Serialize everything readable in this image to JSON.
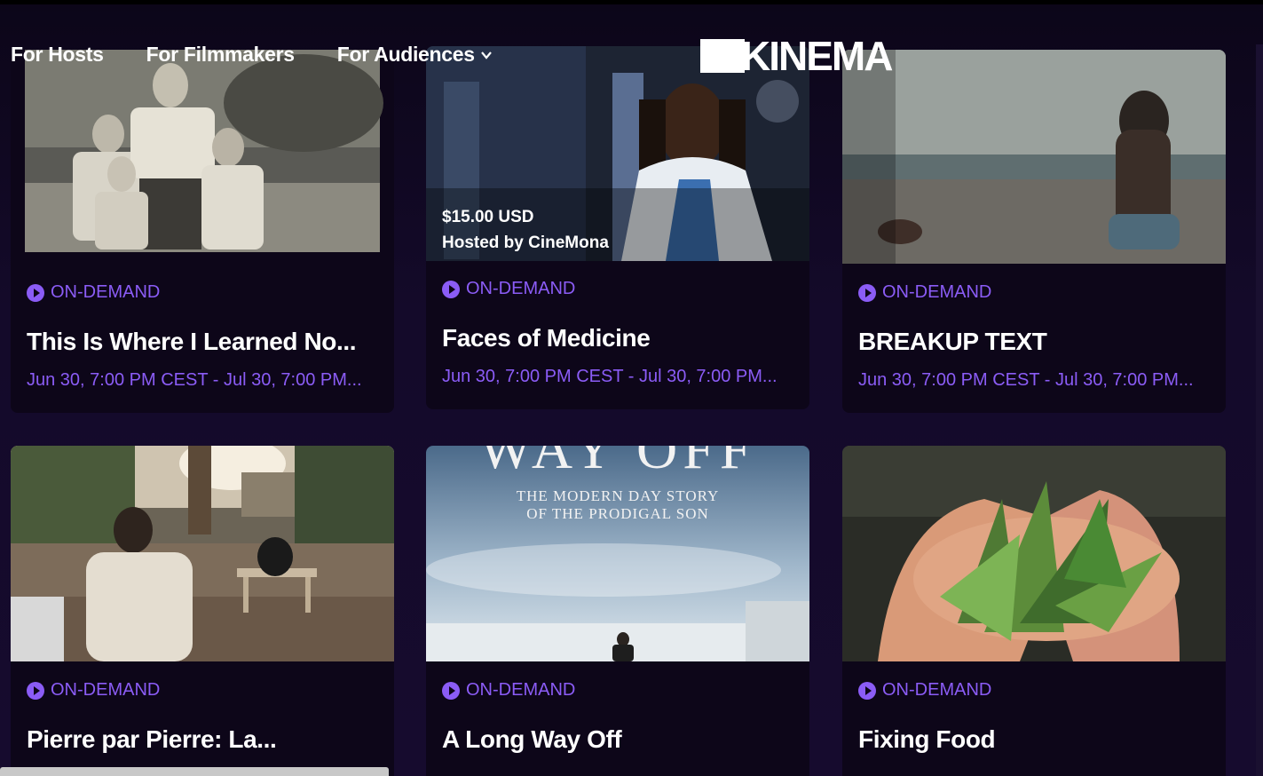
{
  "nav": {
    "hosts": "For Hosts",
    "filmmakers": "For Filmmakers",
    "audiences": "For Audiences"
  },
  "logo": {
    "text": "KINEMA"
  },
  "colors": {
    "accent": "#8b5cf6",
    "background": "#0f0820",
    "card": "#0d0619"
  },
  "cards": [
    {
      "badge": "ON-DEMAND",
      "title": "This Is Where I Learned No...",
      "dates": "Jun 30, 7:00 PM CEST - Jul 30, 7:00 PM..."
    },
    {
      "badge": "ON-DEMAND",
      "title": "Faces of Medicine",
      "dates": "Jun 30, 7:00 PM CEST - Jul 30, 7:00 PM...",
      "price": "$15.00 USD",
      "host": "Hosted by CineMona"
    },
    {
      "badge": "ON-DEMAND",
      "title": "BREAKUP TEXT",
      "dates": "Jun 30, 7:00 PM CEST - Jul 30, 7:00 PM..."
    },
    {
      "badge": "ON-DEMAND",
      "title": "Pierre par Pierre: La..."
    },
    {
      "badge": "ON-DEMAND",
      "title": "A Long Way Off",
      "poster_title": "WAY OFF",
      "poster_tagline_1": "THE MODERN DAY STORY",
      "poster_tagline_2": "OF THE PRODIGAL SON"
    },
    {
      "badge": "ON-DEMAND",
      "title": "Fixing Food"
    }
  ]
}
